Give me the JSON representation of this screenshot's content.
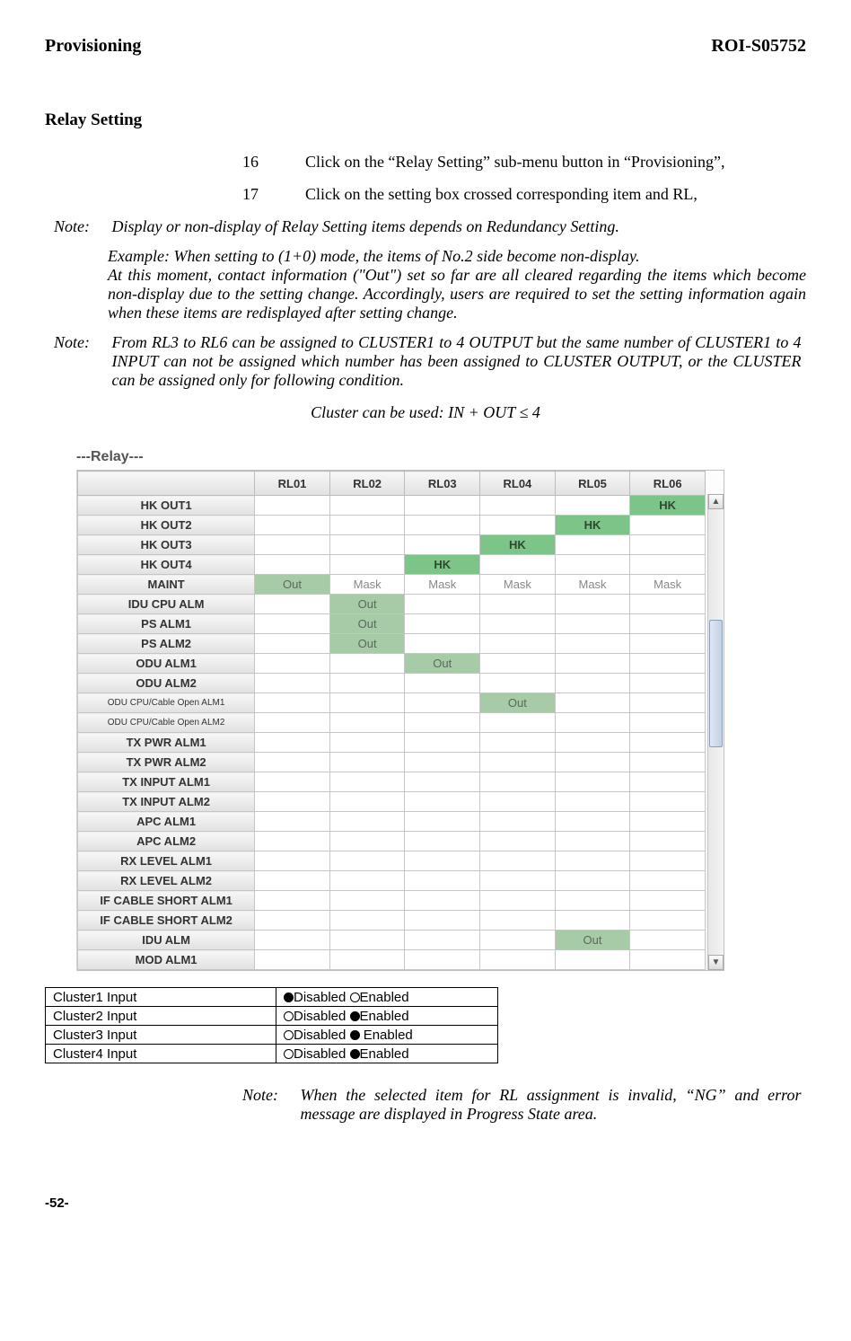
{
  "header": {
    "left": "Provisioning",
    "right": "ROI-S05752"
  },
  "section_title": "Relay Setting",
  "steps": [
    {
      "num": "16",
      "text": "Click on the “Relay Setting” sub-menu button in “Provisioning”,"
    },
    {
      "num": "17",
      "text": "Click on the setting box crossed corresponding item and RL,"
    }
  ],
  "note1_label": "Note:",
  "note1_text": "Display or non-display of Relay Setting items depends on Redundancy Setting.",
  "note1_sub": "Example: When setting to (1+0) mode, the items of  No.2 side become non-display.\nAt this moment, contact information (\"Out\") set so far are all cleared regarding the items which become non-display due to the setting change. Accordingly, users are required to set the setting information again when these items are redisplayed after setting change.",
  "note2_label": "Note:",
  "note2_text": "From RL3 to RL6 can be assigned to CLUSTER1 to 4 OUTPUT but the same number of CLUSTER1 to 4 INPUT can not be assigned which number has been assigned to CLUSTER OUTPUT, or the CLUSTER can be assigned only for following condition.",
  "formula": "Cluster can be used:  IN + OUT ≤  4",
  "relay_panel_title": "---Relay---",
  "relay_columns": [
    "",
    "RL01",
    "RL02",
    "RL03",
    "RL04",
    "RL05",
    "RL06"
  ],
  "relay_rows": [
    {
      "label": "HK OUT1",
      "cells": [
        "",
        "",
        "",
        "",
        "",
        ""
      ],
      "green_idx": 5,
      "green_text": "HK"
    },
    {
      "label": "HK OUT2",
      "cells": [
        "",
        "",
        "",
        "",
        "",
        ""
      ],
      "green_idx": 4,
      "green_text": "HK"
    },
    {
      "label": "HK OUT3",
      "cells": [
        "",
        "",
        "",
        "",
        "",
        ""
      ],
      "green_idx": 3,
      "green_text": "HK"
    },
    {
      "label": "HK OUT4",
      "cells": [
        "",
        "",
        "",
        "",
        "",
        ""
      ],
      "green_idx": 2,
      "green_text": "HK"
    },
    {
      "label": "MAINT",
      "cells": [
        "Out",
        "Mask",
        "Mask",
        "Mask",
        "Mask",
        "Mask"
      ],
      "muted_green_idx": 0
    },
    {
      "label": "IDU CPU ALM",
      "cells": [
        "",
        "Out",
        "",
        "",
        "",
        ""
      ],
      "muted_green_idx": 1
    },
    {
      "label": "PS ALM1",
      "cells": [
        "",
        "Out",
        "",
        "",
        "",
        ""
      ],
      "muted_green_idx": 1
    },
    {
      "label": "PS ALM2",
      "cells": [
        "",
        "Out",
        "",
        "",
        "",
        ""
      ],
      "muted_green_idx": 1
    },
    {
      "label": "ODU ALM1",
      "cells": [
        "",
        "",
        "Out",
        "",
        "",
        ""
      ],
      "muted_green_idx": 2
    },
    {
      "label": "ODU ALM2",
      "cells": [
        "",
        "",
        "",
        "",
        "",
        ""
      ]
    },
    {
      "label": "ODU CPU/Cable Open ALM1",
      "small": true,
      "cells": [
        "",
        "",
        "",
        "Out",
        "",
        ""
      ],
      "muted_green_idx": 3
    },
    {
      "label": "ODU CPU/Cable Open ALM2",
      "small": true,
      "cells": [
        "",
        "",
        "",
        "",
        "",
        ""
      ]
    },
    {
      "label": "TX PWR ALM1",
      "cells": [
        "",
        "",
        "",
        "",
        "",
        ""
      ]
    },
    {
      "label": "TX PWR ALM2",
      "cells": [
        "",
        "",
        "",
        "",
        "",
        ""
      ]
    },
    {
      "label": "TX INPUT ALM1",
      "cells": [
        "",
        "",
        "",
        "",
        "",
        ""
      ]
    },
    {
      "label": "TX INPUT ALM2",
      "cells": [
        "",
        "",
        "",
        "",
        "",
        ""
      ]
    },
    {
      "label": "APC ALM1",
      "cells": [
        "",
        "",
        "",
        "",
        "",
        ""
      ]
    },
    {
      "label": "APC ALM2",
      "cells": [
        "",
        "",
        "",
        "",
        "",
        ""
      ]
    },
    {
      "label": "RX LEVEL ALM1",
      "cells": [
        "",
        "",
        "",
        "",
        "",
        ""
      ]
    },
    {
      "label": "RX LEVEL ALM2",
      "cells": [
        "",
        "",
        "",
        "",
        "",
        ""
      ]
    },
    {
      "label": "IF CABLE SHORT ALM1",
      "cells": [
        "",
        "",
        "",
        "",
        "",
        ""
      ]
    },
    {
      "label": "IF CABLE SHORT ALM2",
      "cells": [
        "",
        "",
        "",
        "",
        "",
        ""
      ]
    },
    {
      "label": "IDU ALM",
      "cells": [
        "",
        "",
        "",
        "",
        "Out",
        ""
      ],
      "muted_green_idx": 4
    },
    {
      "label": "MOD ALM1",
      "cells": [
        "",
        "",
        "",
        "",
        "",
        ""
      ]
    }
  ],
  "cluster_rows": [
    {
      "label": "Cluster1 Input",
      "disabled": true,
      "text_d": "Disabled",
      "text_e": "Enabled"
    },
    {
      "label": "Cluster2 Input",
      "disabled": false,
      "text_d": "Disabled",
      "text_e": "Enabled"
    },
    {
      "label": "Cluster3 Input",
      "disabled": false,
      "text_d": "Disabled",
      "text_e": " Enabled"
    },
    {
      "label": "Cluster4 Input",
      "disabled": false,
      "text_d": "Disabled",
      "text_e": "Enabled"
    }
  ],
  "bottom_note_label": "Note:",
  "bottom_note_text": "When the selected item for RL assignment is invalid, “NG” and error message are displayed in Progress State area.",
  "page_number": "-52-"
}
